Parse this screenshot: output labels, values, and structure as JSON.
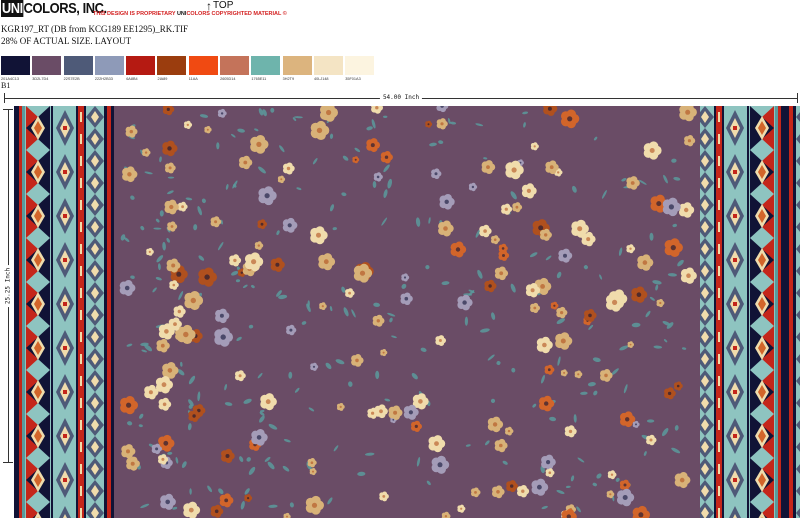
{
  "header": {
    "logo_part_a": "UNI",
    "logo_part_b": "COLORS, INC.",
    "notice_part_a": "THIS DESIGN IS PROPRIETARY ",
    "notice_brand_a": "UNI",
    "notice_brand_b": "COLORS",
    "notice_part_b": " COPYRIGHTED MATERIAL ©",
    "top_arrow": "↑",
    "top_label": "TOP"
  },
  "design": {
    "filename": "KGR197_RT (DB from KCG189 EE1295)_RK.TIF",
    "scale": "28% OF ACTUAL SIZE. LAYOUT",
    "variant": "B1",
    "width_label": "54.00 Inch",
    "height_label": "25.25 Inch"
  },
  "palette": [
    {
      "code": "201A4C13",
      "color": "#111336"
    },
    {
      "code": "3D2L7D4",
      "color": "#6a4c66"
    },
    {
      "code": "22S7E2B",
      "color": "#4e5a78"
    },
    {
      "code": "222H2B33",
      "color": "#8e9ab8"
    },
    {
      "code": "6A8B4",
      "color": "#b51a12"
    },
    {
      "code": "2IA89",
      "color": "#9b3d0e"
    },
    {
      "code": "11AA",
      "color": "#f04a12"
    },
    {
      "code": "2605D14",
      "color": "#c4735a"
    },
    {
      "code": "1765E11",
      "color": "#6eb4ac"
    },
    {
      "code": "3H2T9",
      "color": "#dcb47e"
    },
    {
      "code": "40LJ148",
      "color": "#f4e4c4"
    },
    {
      "code": "35F01A3",
      "color": "#fcf4e0"
    }
  ],
  "fabric_colors": {
    "ground": "#6a4c66",
    "rust": "#b0501e",
    "orange": "#d2652a",
    "cream": "#f0dcac",
    "gold": "#d8b278",
    "lavender": "#a49cb8",
    "teal": "#5a9a9c",
    "navy": "#111336",
    "red": "#c4261a",
    "light_teal": "#8ec4c0",
    "slate": "#4e5a78"
  }
}
